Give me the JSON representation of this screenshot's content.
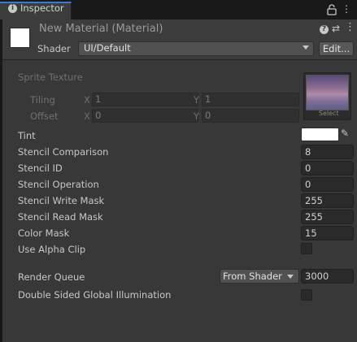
{
  "tab": {
    "icon": "info-icon",
    "label": "Inspector",
    "lock_icon": "lock-icon",
    "menu_icon": "kebab-menu-icon"
  },
  "header": {
    "title": "New Material (Material)",
    "icons": [
      "help-icon",
      "preset-settings-icon",
      "more-options-icon"
    ],
    "shader_label": "Shader",
    "shader_value": "UI/Default",
    "edit_label": "Edit..."
  },
  "sprite": {
    "label": "Sprite Texture",
    "select_label": "Select",
    "tiling": {
      "label": "Tiling",
      "x_letter": "X",
      "x": "1",
      "y_letter": "Y",
      "y": "1"
    },
    "offset": {
      "label": "Offset",
      "x_letter": "X",
      "x": "0",
      "y_letter": "Y",
      "y": "0"
    }
  },
  "properties": {
    "tint": {
      "label": "Tint",
      "color": "#ffffff"
    },
    "stencil_comparison": {
      "label": "Stencil Comparison",
      "value": "8"
    },
    "stencil_id": {
      "label": "Stencil ID",
      "value": "0"
    },
    "stencil_operation": {
      "label": "Stencil Operation",
      "value": "0"
    },
    "stencil_write_mask": {
      "label": "Stencil Write Mask",
      "value": "255"
    },
    "stencil_read_mask": {
      "label": "Stencil Read Mask",
      "value": "255"
    },
    "color_mask": {
      "label": "Color Mask",
      "value": "15"
    },
    "use_alpha_clip": {
      "label": "Use Alpha Clip",
      "checked": false
    },
    "render_queue": {
      "label": "Render Queue",
      "mode": "From Shader",
      "value": "3000"
    },
    "double_sided_gi": {
      "label": "Double Sided Global Illumination",
      "checked": false
    }
  },
  "colors": {
    "accent": "#3a78d9",
    "panel": "#383838",
    "field": "#2a2a2a"
  }
}
